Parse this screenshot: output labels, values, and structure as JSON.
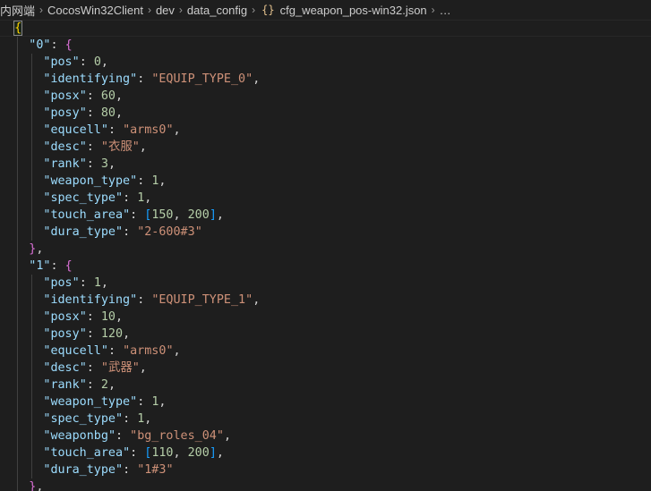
{
  "breadcrumb": {
    "segments": [
      "内网端",
      "CocosWin32Client",
      "dev",
      "data_config"
    ],
    "file_icon": "{}",
    "file": "cfg_weapon_pos-win32.json",
    "ellipsis": "…"
  },
  "lines": [
    {
      "t": "open_root"
    },
    {
      "t": "obj_open",
      "key": "0"
    },
    {
      "t": "kv",
      "key": "pos",
      "type": "n",
      "value": "0",
      "comma": true
    },
    {
      "t": "kv",
      "key": "identifying",
      "type": "s",
      "value": "EQUIP_TYPE_0",
      "comma": true
    },
    {
      "t": "kv",
      "key": "posx",
      "type": "n",
      "value": "60",
      "comma": true
    },
    {
      "t": "kv",
      "key": "posy",
      "type": "n",
      "value": "80",
      "comma": true
    },
    {
      "t": "kv",
      "key": "equcell",
      "type": "s",
      "value": "arms0",
      "comma": true
    },
    {
      "t": "kv",
      "key": "desc",
      "type": "s",
      "value": "衣服",
      "comma": true
    },
    {
      "t": "kv",
      "key": "rank",
      "type": "n",
      "value": "3",
      "comma": true
    },
    {
      "t": "kv",
      "key": "weapon_type",
      "type": "n",
      "value": "1",
      "comma": true
    },
    {
      "t": "kv",
      "key": "spec_type",
      "type": "n",
      "value": "1",
      "comma": true
    },
    {
      "t": "kv",
      "key": "touch_area",
      "type": "arr",
      "value": [
        "150",
        "200"
      ],
      "comma": true
    },
    {
      "t": "kv",
      "key": "dura_type",
      "type": "s",
      "value": "2-600#3",
      "comma": false
    },
    {
      "t": "obj_close",
      "comma": true
    },
    {
      "t": "obj_open",
      "key": "1"
    },
    {
      "t": "kv",
      "key": "pos",
      "type": "n",
      "value": "1",
      "comma": true
    },
    {
      "t": "kv",
      "key": "identifying",
      "type": "s",
      "value": "EQUIP_TYPE_1",
      "comma": true
    },
    {
      "t": "kv",
      "key": "posx",
      "type": "n",
      "value": "10",
      "comma": true
    },
    {
      "t": "kv",
      "key": "posy",
      "type": "n",
      "value": "120",
      "comma": true
    },
    {
      "t": "kv",
      "key": "equcell",
      "type": "s",
      "value": "arms0",
      "comma": true
    },
    {
      "t": "kv",
      "key": "desc",
      "type": "s",
      "value": "武器",
      "comma": true
    },
    {
      "t": "kv",
      "key": "rank",
      "type": "n",
      "value": "2",
      "comma": true
    },
    {
      "t": "kv",
      "key": "weapon_type",
      "type": "n",
      "value": "1",
      "comma": true
    },
    {
      "t": "kv",
      "key": "spec_type",
      "type": "n",
      "value": "1",
      "comma": true
    },
    {
      "t": "kv",
      "key": "weaponbg",
      "type": "s",
      "value": "bg_roles_04",
      "comma": true
    },
    {
      "t": "kv",
      "key": "touch_area",
      "type": "arr",
      "value": [
        "110",
        "200"
      ],
      "comma": true
    },
    {
      "t": "kv",
      "key": "dura_type",
      "type": "s",
      "value": "1#3",
      "comma": false
    },
    {
      "t": "obj_close",
      "comma": true
    }
  ]
}
